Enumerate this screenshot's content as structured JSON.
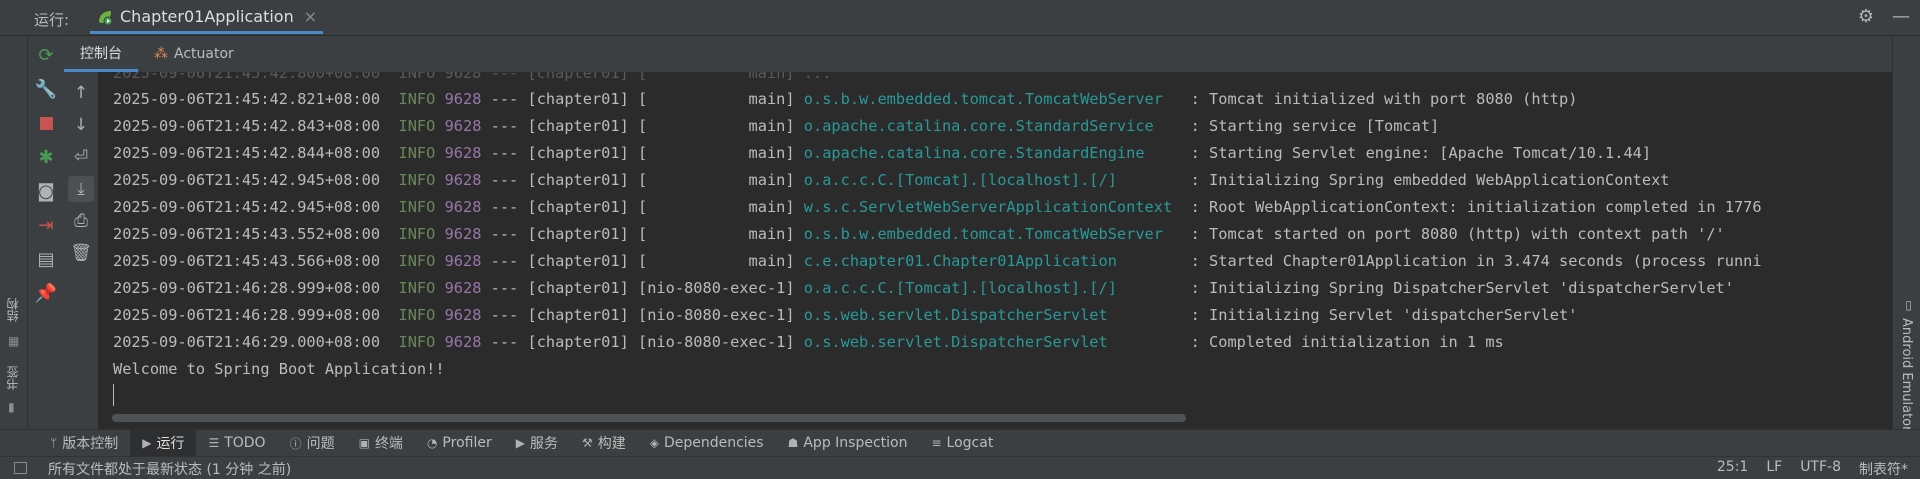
{
  "header": {
    "run_label": "运行:",
    "tab_title": "Chapter01Application",
    "tab_close": "×",
    "settings_glyph": "⚙",
    "minimize_glyph": "—"
  },
  "subtabs": [
    {
      "label": "控制台",
      "icon": "console-icon"
    },
    {
      "label": "Actuator",
      "icon": "actuator-icon"
    }
  ],
  "left_strip": {
    "structure": "结构",
    "bookmarks": "书签"
  },
  "right_strip": {
    "emulator": "Android Emulator"
  },
  "console": {
    "lines": [
      {
        "ts": "2025-09-06T21:45:42.821+08:00",
        "level": "INFO",
        "pid": "9628",
        "sep": "---",
        "app": "[chapter01]",
        "thread": "[           main]",
        "logger": "o.s.b.w.embedded.tomcat.TomcatWebServer  ",
        "msg": ": Tomcat initialized with port 8080 (http)"
      },
      {
        "ts": "2025-09-06T21:45:42.843+08:00",
        "level": "INFO",
        "pid": "9628",
        "sep": "---",
        "app": "[chapter01]",
        "thread": "[           main]",
        "logger": "o.apache.catalina.core.StandardService   ",
        "msg": ": Starting service [Tomcat]"
      },
      {
        "ts": "2025-09-06T21:45:42.844+08:00",
        "level": "INFO",
        "pid": "9628",
        "sep": "---",
        "app": "[chapter01]",
        "thread": "[           main]",
        "logger": "o.apache.catalina.core.StandardEngine    ",
        "msg": ": Starting Servlet engine: [Apache Tomcat/10.1.44]"
      },
      {
        "ts": "2025-09-06T21:45:42.945+08:00",
        "level": "INFO",
        "pid": "9628",
        "sep": "---",
        "app": "[chapter01]",
        "thread": "[           main]",
        "logger": "o.a.c.c.C.[Tomcat].[localhost].[/]       ",
        "msg": ": Initializing Spring embedded WebApplicationContext"
      },
      {
        "ts": "2025-09-06T21:45:42.945+08:00",
        "level": "INFO",
        "pid": "9628",
        "sep": "---",
        "app": "[chapter01]",
        "thread": "[           main]",
        "logger": "w.s.c.ServletWebServerApplicationContext ",
        "msg": ": Root WebApplicationContext: initialization completed in 1776"
      },
      {
        "ts": "2025-09-06T21:45:43.552+08:00",
        "level": "INFO",
        "pid": "9628",
        "sep": "---",
        "app": "[chapter01]",
        "thread": "[           main]",
        "logger": "o.s.b.w.embedded.tomcat.TomcatWebServer  ",
        "msg": ": Tomcat started on port 8080 (http) with context path '/'"
      },
      {
        "ts": "2025-09-06T21:45:43.566+08:00",
        "level": "INFO",
        "pid": "9628",
        "sep": "---",
        "app": "[chapter01]",
        "thread": "[           main]",
        "logger": "c.e.chapter01.Chapter01Application       ",
        "msg": ": Started Chapter01Application in 3.474 seconds (process runni"
      },
      {
        "ts": "2025-09-06T21:46:28.999+08:00",
        "level": "INFO",
        "pid": "9628",
        "sep": "---",
        "app": "[chapter01]",
        "thread": "[nio-8080-exec-1]",
        "logger": "o.a.c.c.C.[Tomcat].[localhost].[/]       ",
        "msg": ": Initializing Spring DispatcherServlet 'dispatcherServlet'"
      },
      {
        "ts": "2025-09-06T21:46:28.999+08:00",
        "level": "INFO",
        "pid": "9628",
        "sep": "---",
        "app": "[chapter01]",
        "thread": "[nio-8080-exec-1]",
        "logger": "o.s.web.servlet.DispatcherServlet        ",
        "msg": ": Initializing Servlet 'dispatcherServlet'"
      },
      {
        "ts": "2025-09-06T21:46:29.000+08:00",
        "level": "INFO",
        "pid": "9628",
        "sep": "---",
        "app": "[chapter01]",
        "thread": "[nio-8080-exec-1]",
        "logger": "o.s.web.servlet.DispatcherServlet        ",
        "msg": ": Completed initialization in 1 ms"
      }
    ],
    "welcome": "Welcome to Spring Boot Application!!"
  },
  "bottom_tabs": [
    {
      "label": "版本控制",
      "icon": "git-branch-icon",
      "glyph": "ᛘ"
    },
    {
      "label": "运行",
      "icon": "run-icon",
      "glyph": "▶"
    },
    {
      "label": "TODO",
      "icon": "todo-icon",
      "glyph": "☰"
    },
    {
      "label": "问题",
      "icon": "problems-icon",
      "glyph": "ⓘ"
    },
    {
      "label": "终端",
      "icon": "terminal-icon",
      "glyph": "▣"
    },
    {
      "label": "Profiler",
      "icon": "profiler-icon",
      "glyph": "◔"
    },
    {
      "label": "服务",
      "icon": "services-icon",
      "glyph": "▶"
    },
    {
      "label": "构建",
      "icon": "build-icon",
      "glyph": "⚒"
    },
    {
      "label": "Dependencies",
      "icon": "dependencies-icon",
      "glyph": "◈"
    },
    {
      "label": "App Inspection",
      "icon": "app-inspection-icon",
      "glyph": "☗"
    },
    {
      "label": "Logcat",
      "icon": "logcat-icon",
      "glyph": "≡"
    }
  ],
  "status": {
    "message": "所有文件都处于最新状态 (1 分钟 之前)",
    "position": "25:1",
    "line_ending": "LF",
    "encoding": "UTF-8",
    "indent": "制表符*"
  },
  "colors": {
    "accent": "#4a88c7",
    "info": "#6a8759",
    "pid": "#9876aa",
    "logger": "#299999"
  }
}
